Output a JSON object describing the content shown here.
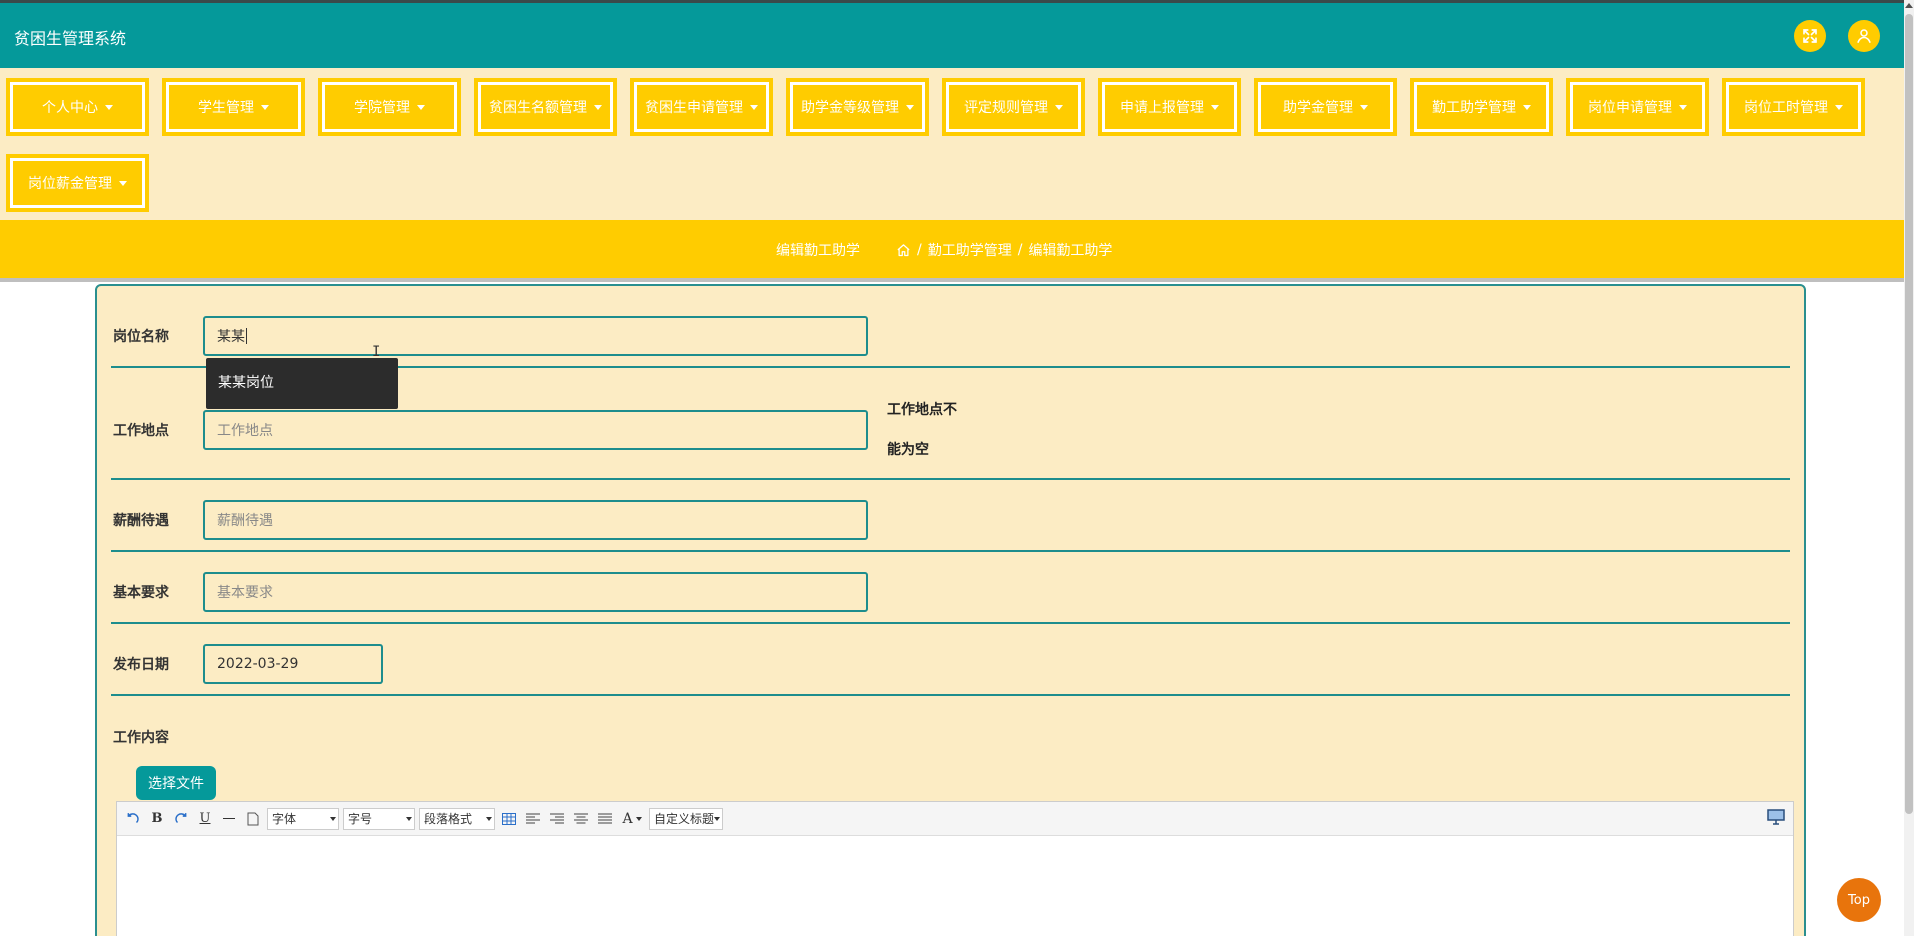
{
  "header": {
    "title": "贫困生管理系统",
    "icons": [
      "fullscreen-icon",
      "user-icon"
    ],
    "accent": "#05999a"
  },
  "nav": {
    "items": [
      {
        "label": "个人中心"
      },
      {
        "label": "学生管理"
      },
      {
        "label": "学院管理"
      },
      {
        "label": "贫困生名额管理"
      },
      {
        "label": "贫困生申请管理"
      },
      {
        "label": "助学金等级管理"
      },
      {
        "label": "评定规则管理"
      },
      {
        "label": "申请上报管理"
      },
      {
        "label": "助学金管理"
      },
      {
        "label": "勤工助学管理"
      },
      {
        "label": "岗位申请管理"
      },
      {
        "label": "岗位工时管理"
      },
      {
        "label": "岗位薪金管理"
      }
    ],
    "button_color": "#ffcc00"
  },
  "breadcrumb": {
    "page_title": "编辑勤工助学",
    "trail": [
      "勤工助学管理",
      "编辑勤工助学"
    ],
    "separator": "/"
  },
  "form": {
    "post_name": {
      "label": "岗位名称",
      "value": "某某"
    },
    "autocomplete_suggestion": "某某岗位",
    "location": {
      "label": "工作地点",
      "placeholder": "工作地点",
      "error": "工作地点不能为空"
    },
    "salary": {
      "label": "薪酬待遇",
      "placeholder": "薪酬待遇"
    },
    "requirements": {
      "label": "基本要求",
      "placeholder": "基本要求"
    },
    "publish_date": {
      "label": "发布日期",
      "value": "2022-03-29"
    },
    "work_content": {
      "label": "工作内容"
    },
    "upload_label": "选择文件"
  },
  "editor": {
    "font_family_select": "字体",
    "font_size_select": "字号",
    "paragraph_select": "段落格式",
    "custom_title_select": "自定义标题"
  },
  "back_to_top": "Top"
}
